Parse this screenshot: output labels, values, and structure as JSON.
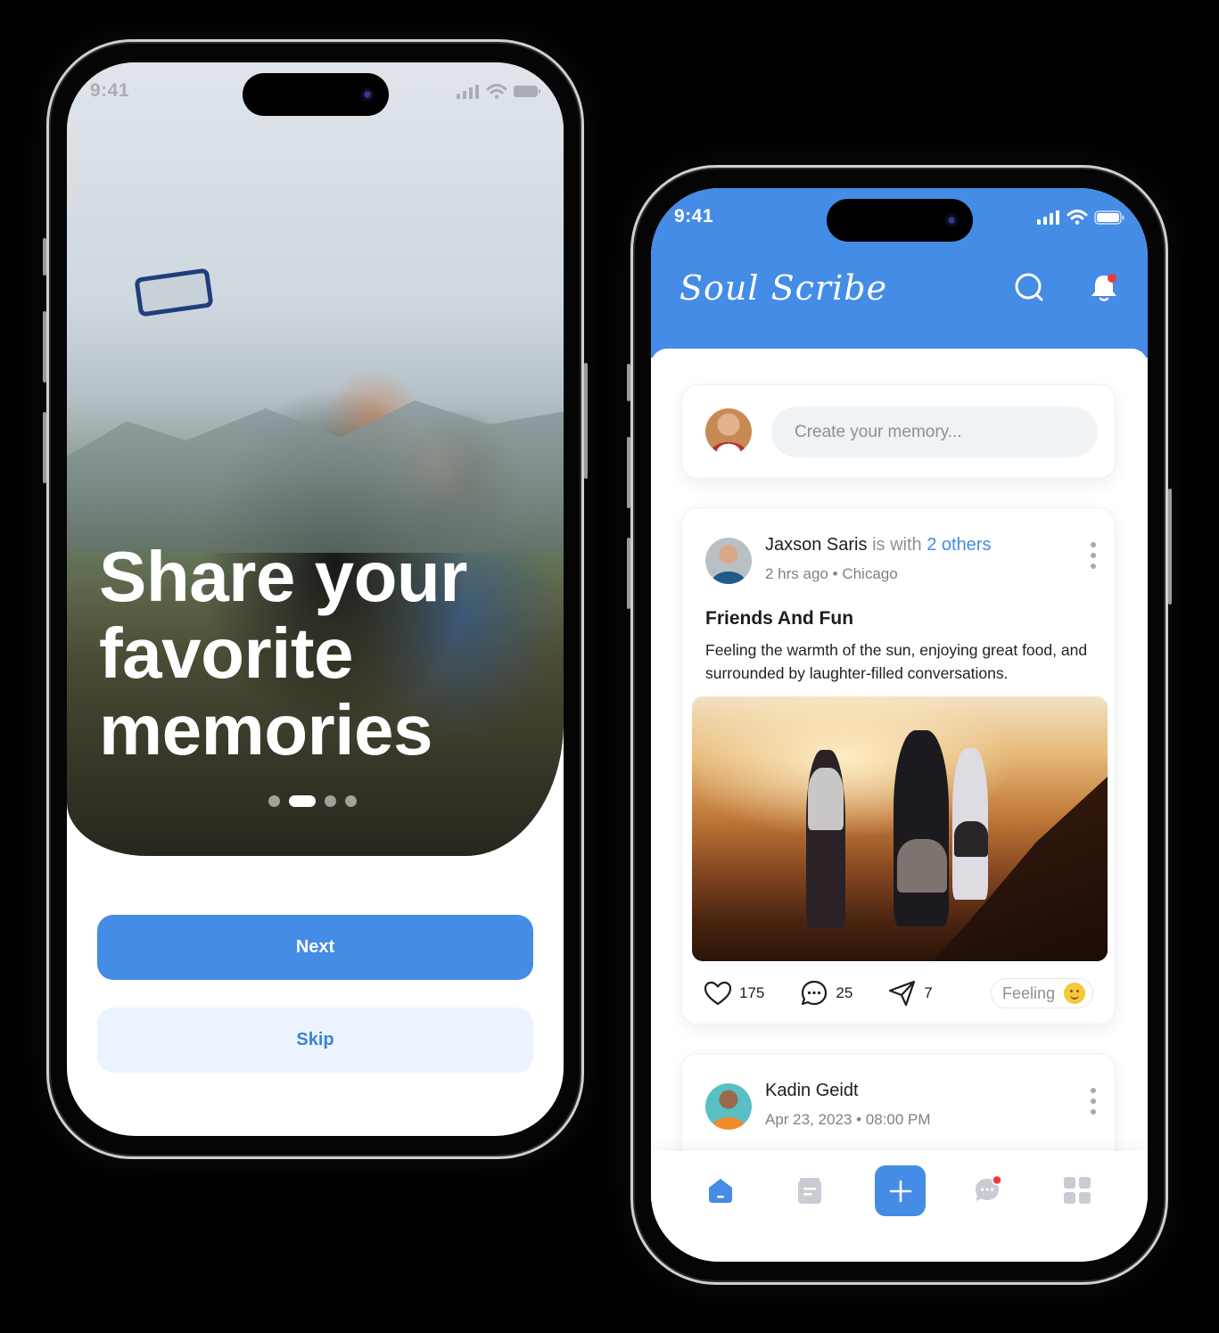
{
  "onboarding": {
    "status_bar": {
      "time": "9:41"
    },
    "hero": {
      "title_lines": [
        "Share your",
        "favorite",
        "memories"
      ]
    },
    "pager": {
      "total": 4,
      "active_index": 1
    },
    "buttons": {
      "next_label": "Next",
      "skip_label": "Skip"
    }
  },
  "feed": {
    "status_bar": {
      "time": "9:41"
    },
    "app_title": "Soul Scribe",
    "header_icons": [
      "search-icon",
      "bell-icon"
    ],
    "composer": {
      "placeholder": "Create your memory..."
    },
    "posts": [
      {
        "author": "Jaxson Saris",
        "with_text": "is with",
        "with_link": "2 others",
        "time": "2 hrs ago",
        "separator": "•",
        "location": "Chicago",
        "title": "Friends And Fun",
        "body": "Feeling the warmth of the sun, enjoying great food, and surrounded by laughter-filled conversations.",
        "likes": "175",
        "comments": "25",
        "shares": "7",
        "feeling_label": "Feeling"
      },
      {
        "author": "Kadin Geidt",
        "date": "Apr 23, 2023",
        "separator": "•",
        "time": "08:00 PM"
      }
    ],
    "tabbar": {
      "items": [
        "home-icon",
        "journal-icon",
        "add-icon",
        "chat-icon",
        "grid-icon"
      ],
      "active": "home-icon"
    }
  },
  "colors": {
    "primary": "#448ce6",
    "secondary_bg": "#ebf3fe",
    "badge": "#ef3a3a",
    "muted_text": "#8a9099"
  }
}
